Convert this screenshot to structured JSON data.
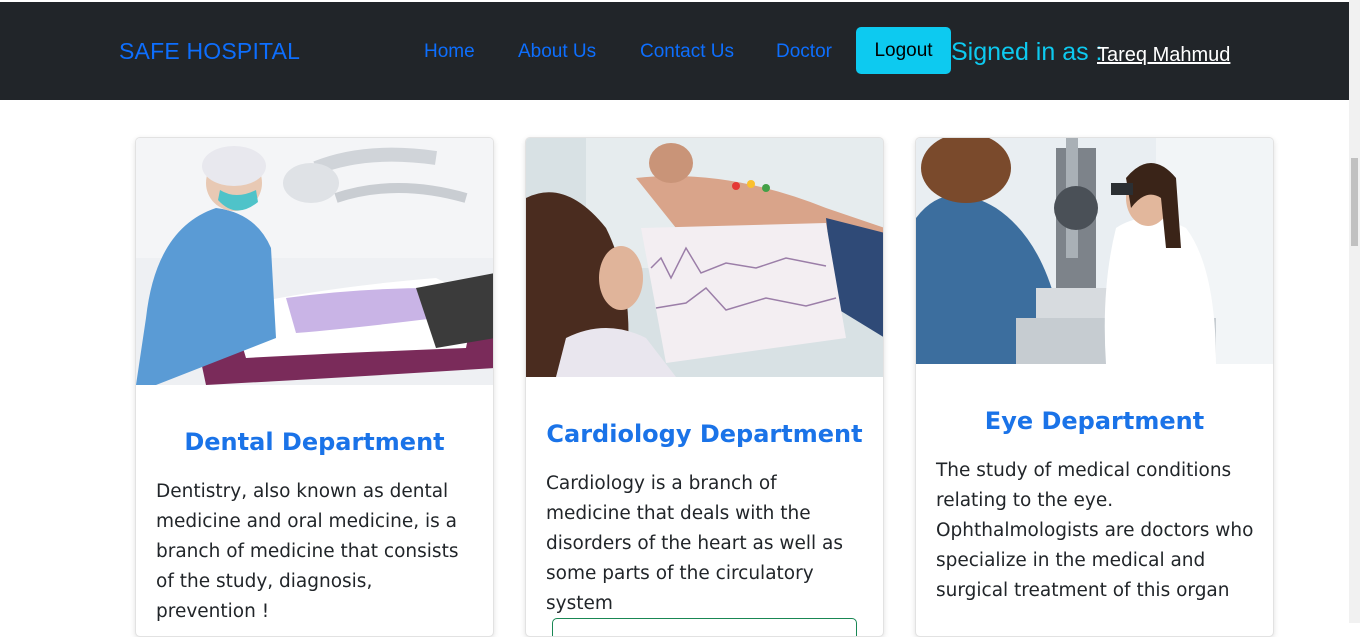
{
  "navbar": {
    "brand": "SAFE HOSPITAL",
    "links": [
      "Home",
      "About Us",
      "Contact Us",
      "Doctor"
    ],
    "logout_label": "Logout",
    "signed_in_label": "Signed in as :",
    "username": "Tareq Mahmud"
  },
  "cards": [
    {
      "title": "Dental Department",
      "description": "Dentistry, also known as dental medicine and oral medicine, is a branch of medicine that consists of the study, diagnosis, prevention !"
    },
    {
      "title": "Cardiology Department",
      "description": "Cardiology is a branch of medicine that deals with the disorders of the heart as well as some parts of the circulatory system"
    },
    {
      "title": "Eye Department",
      "description": "The study of medical conditions relating to the eye. Ophthalmologists are doctors who specialize in the medical and surgical treatment of this organ"
    }
  ],
  "colors": {
    "navbar_bg": "#212529",
    "link": "#0d6efd",
    "accent": "#0dcaf0",
    "card_title": "#1a73e8"
  }
}
